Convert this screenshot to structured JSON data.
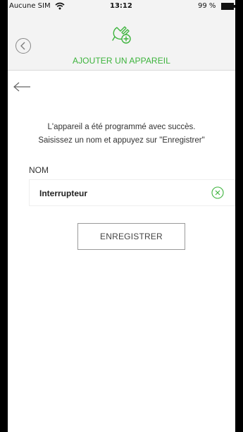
{
  "status_bar": {
    "carrier": "Aucune SIM",
    "time": "13:12",
    "battery": "99 %",
    "wifi_icon": "wifi-icon",
    "battery_icon": "battery-icon"
  },
  "header": {
    "title": "AJOUTER UN APPAREIL",
    "back_icon": "chevron-left-circle-icon",
    "logo_icon": "plug-add-icon",
    "accent_color": "#3cb33c"
  },
  "nav": {
    "back_arrow_icon": "arrow-left-icon"
  },
  "message": {
    "line1": "L'appareil a été programmé avec succès.",
    "line2": "Saisissez un nom et appuyez sur \"Enregistrer\""
  },
  "form": {
    "name_label": "NOM",
    "name_value": "Interrupteur",
    "clear_icon": "clear-circle-icon"
  },
  "actions": {
    "save_label": "ENREGISTRER"
  }
}
